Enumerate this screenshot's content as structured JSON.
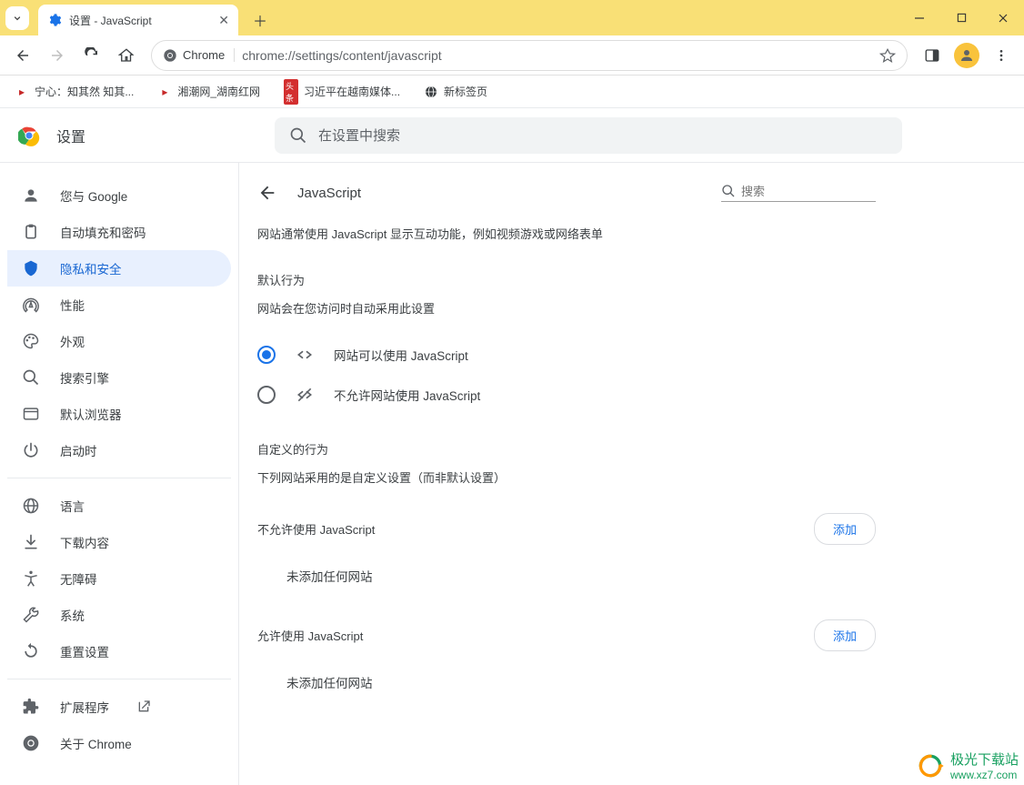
{
  "browser": {
    "tab_title": "设置 - JavaScript",
    "omnibox_label": "Chrome",
    "url": "chrome://settings/content/javascript"
  },
  "bookmarks": [
    {
      "label": "宁心：知其然 知其..."
    },
    {
      "label": "湘潮网_湖南红网"
    },
    {
      "label": "习近平在越南媒体..."
    },
    {
      "label": "新标签页"
    }
  ],
  "settings": {
    "title": "设置",
    "search_placeholder": "在设置中搜索"
  },
  "sidebar": {
    "items": [
      {
        "label": "您与 Google"
      },
      {
        "label": "自动填充和密码"
      },
      {
        "label": "隐私和安全"
      },
      {
        "label": "性能"
      },
      {
        "label": "外观"
      },
      {
        "label": "搜索引擎"
      },
      {
        "label": "默认浏览器"
      },
      {
        "label": "启动时"
      }
    ],
    "items2": [
      {
        "label": "语言"
      },
      {
        "label": "下载内容"
      },
      {
        "label": "无障碍"
      },
      {
        "label": "系统"
      },
      {
        "label": "重置设置"
      }
    ],
    "items3": [
      {
        "label": "扩展程序"
      },
      {
        "label": "关于 Chrome"
      }
    ]
  },
  "content": {
    "title": "JavaScript",
    "search_placeholder": "搜索",
    "description": "网站通常使用 JavaScript 显示互动功能，例如视频游戏或网络表单",
    "default_label": "默认行为",
    "default_sub": "网站会在您访问时自动采用此设置",
    "radio_allow": "网站可以使用 JavaScript",
    "radio_block": "不允许网站使用 JavaScript",
    "custom_label": "自定义的行为",
    "custom_sub": "下列网站采用的是自定义设置（而非默认设置）",
    "block_header": "不允许使用 JavaScript",
    "allow_header": "允许使用 JavaScript",
    "add_button": "添加",
    "empty": "未添加任何网站"
  },
  "watermark": {
    "name": "极光下载站",
    "url": "www.xz7.com"
  }
}
